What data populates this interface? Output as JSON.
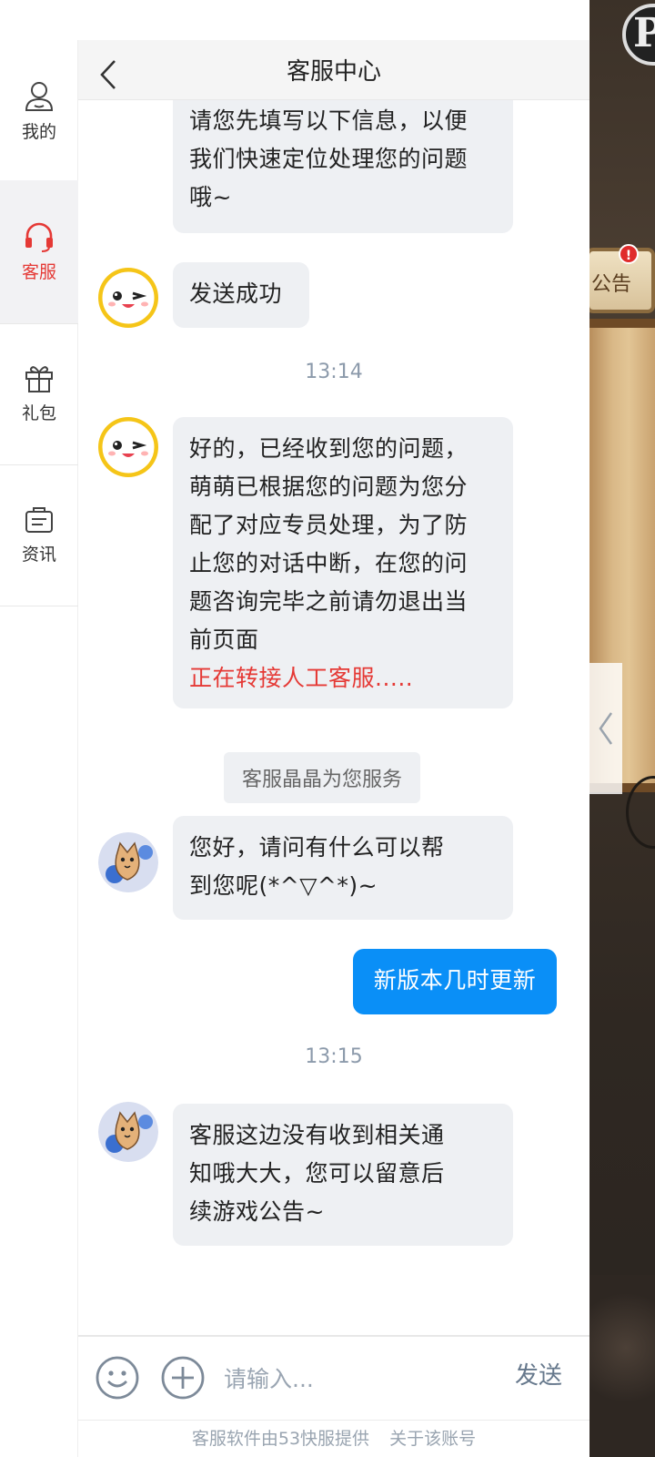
{
  "sidebar": {
    "items": [
      {
        "label": "我的",
        "icon": "user-icon"
      },
      {
        "label": "客服",
        "icon": "headset-icon"
      },
      {
        "label": "礼包",
        "icon": "gift-icon"
      },
      {
        "label": "资讯",
        "icon": "news-icon"
      }
    ],
    "active_color": "#e53935"
  },
  "header": {
    "title": "客服中心",
    "back_icon": "back-chevron-icon"
  },
  "game": {
    "notice_label": "公告",
    "badge": "!",
    "logo_letter": "P"
  },
  "messages": {
    "m1": {
      "lines": [
        "请您先填写以下信息，以便",
        "我们快速定位处理您的问题",
        "哦~"
      ]
    },
    "m2": {
      "text": "发送成功"
    },
    "time1": "13:14",
    "m3": {
      "lines": [
        "好的，已经收到您的问题，",
        "萌萌已根据您的问题为您分",
        "配了对应专员处理，为了防",
        "止您的对话中断，在您的问",
        "题咨询完毕之前请勿退出当",
        "前页面"
      ],
      "highlight": "正在转接人工客服....."
    },
    "system": "客服晶晶为您服务",
    "m4": {
      "lines": [
        "您好，请问有什么可以帮",
        "到您呢(*^▽^*)~"
      ]
    },
    "m5": {
      "text": "新版本几时更新"
    },
    "time2": "13:15",
    "m6": {
      "lines": [
        "客服这边没有收到相关通",
        "知哦大大，您可以留意后",
        "续游戏公告~"
      ]
    }
  },
  "input": {
    "placeholder": "请输入...",
    "send_label": "发送"
  },
  "footer": {
    "provider": "客服软件由53快服提供",
    "about": "关于该账号"
  },
  "colors": {
    "my_bubble": "#0a8ff7",
    "bot_bubble": "#eef0f3",
    "time_text": "#8c9aab"
  }
}
